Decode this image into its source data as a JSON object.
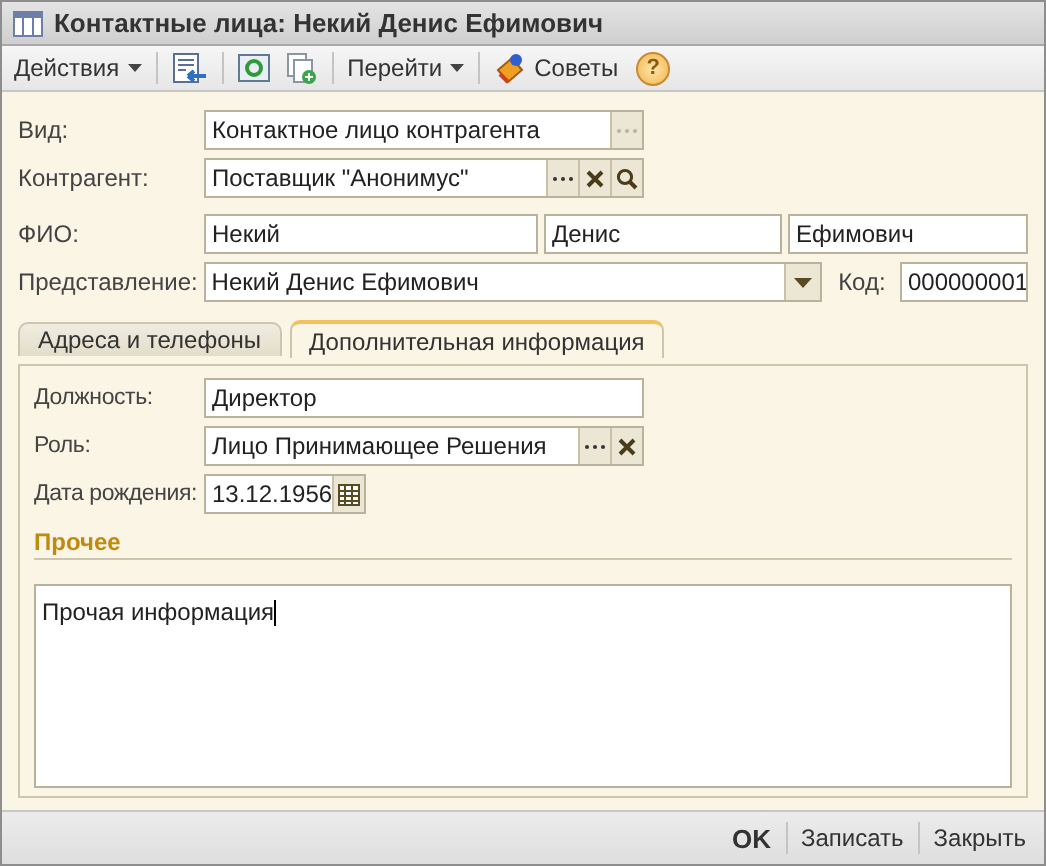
{
  "window": {
    "title": "Контактные лица: Некий Денис Ефимович"
  },
  "toolbar": {
    "actions": "Действия",
    "goto": "Перейти",
    "tips": "Советы",
    "help": "?"
  },
  "type_field": {
    "label": "Вид:",
    "value": "Контактное лицо контрагента"
  },
  "counterparty": {
    "label": "Контрагент:",
    "value": "Поставщик \"Анонимус\""
  },
  "full_name": {
    "label": "ФИО:",
    "parts": [
      "Некий",
      "Денис",
      "Ефимович"
    ]
  },
  "presentation": {
    "label": "Представление:",
    "value": "Некий Денис Ефимович"
  },
  "code": {
    "label": "Код:",
    "value": "000000001"
  },
  "tabs": [
    {
      "label": "Адреса и телефоны",
      "selected": false
    },
    {
      "label": "Дополнительная информация",
      "selected": true
    }
  ],
  "details": {
    "position": {
      "label": "Должность:",
      "value": "Директор"
    },
    "role": {
      "label": "Роль:",
      "value": "Лицо Принимающее Решения"
    },
    "birth_date": {
      "label": "Дата рождения:",
      "value": "13.12.1956"
    },
    "other": {
      "heading": "Прочее",
      "value": "Прочая информация"
    }
  },
  "buttons": [
    {
      "label": "OK",
      "default": true
    },
    {
      "label": "Записать",
      "default": false
    },
    {
      "label": "Закрыть",
      "default": false
    }
  ]
}
